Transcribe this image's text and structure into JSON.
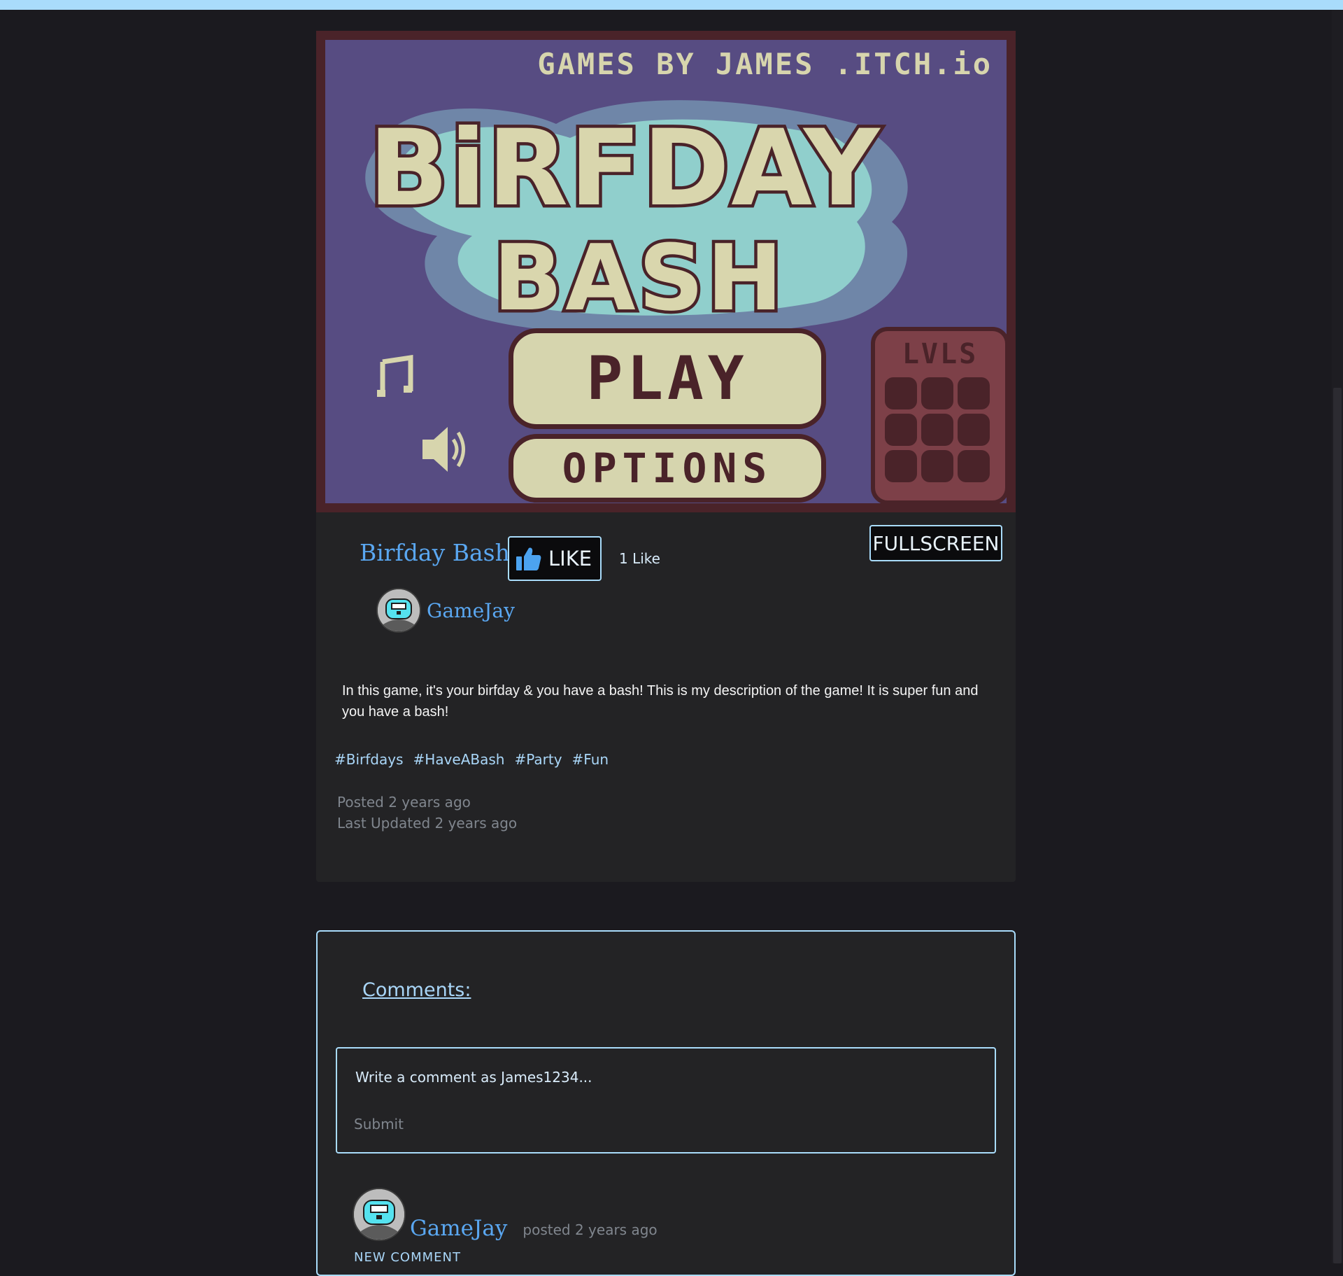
{
  "game": {
    "screen": {
      "credit": "GAMES BY JAMES .ITCH.io",
      "title_line1": "BiRFDAY",
      "title_line2": "BASH",
      "play_label": "PLAY",
      "options_label": "OPTIONS",
      "levels_label": "LVLS"
    },
    "title": "Birfday Bash",
    "like_label": "LIKE",
    "like_count": "1 Like",
    "fullscreen_label": "FULLSCREEN",
    "author": "GameJay",
    "description": "In this game, it's your birfday & you have a bash! This is my description of the game! It is super fun and you have a bash!",
    "tags": [
      "#Birfdays",
      "#HaveABash",
      "#Party",
      "#Fun"
    ],
    "posted": "Posted 2 years ago",
    "updated": "Last Updated 2 years ago"
  },
  "comments": {
    "heading": "Comments:",
    "input_placeholder": "Write a comment as James1234...",
    "submit_label": "Submit",
    "items": [
      {
        "author": "GameJay",
        "time": "posted 2 years ago",
        "text": "NEW COMMENT"
      }
    ]
  },
  "colors": {
    "accent": "#a9dcfb",
    "link": "#5aa7f1",
    "page_bg": "#1b1a1f",
    "card_bg": "#232325",
    "game_frame": "#4a2329",
    "game_bg": "#574c82"
  },
  "icons": [
    "thumbs-up-icon",
    "music-note-icon",
    "speaker-icon",
    "controller-avatar-icon"
  ]
}
